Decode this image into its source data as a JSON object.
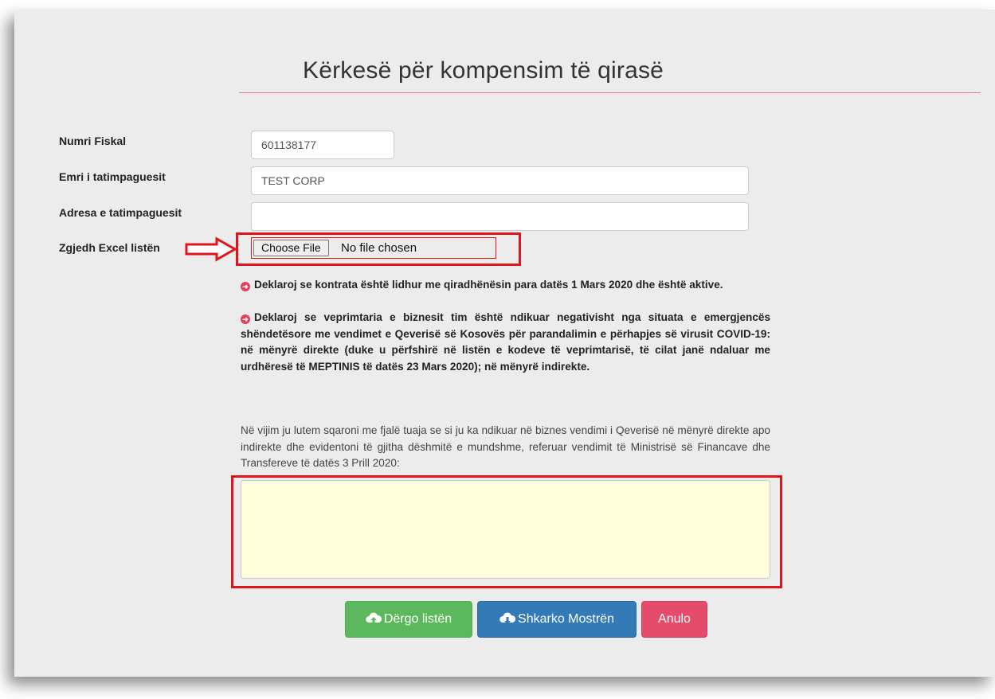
{
  "page": {
    "title": "Kërkesë për kompensim të qirasë"
  },
  "form": {
    "fiscal_number": {
      "label": "Numri Fiskal",
      "value": "601138177"
    },
    "taxpayer_name": {
      "label": "Emri i tatimpaguesit",
      "value": "TEST CORP"
    },
    "taxpayer_address": {
      "label": "Adresa e tatimpaguesit",
      "value": ""
    },
    "excel_file": {
      "label": "Zgjedh Excel listën",
      "button_label": "Choose File",
      "status": "No file chosen"
    }
  },
  "declarations": {
    "line1": "Deklaroj se kontrata është lidhur me qiradhënësin para datës 1 Mars 2020 dhe është aktive.",
    "line2": "Deklaroj se veprimtaria e biznesit tim është ndikuar negativisht nga situata e emergjencës shëndetësore me vendimet e Qeverisë së Kosovës për parandalimin e përhapjes së virusit COVID-19: në mënyrë direkte (duke u përfshirë në listën e kodeve të veprimtarisë, të cilat janë ndaluar me urdhëresë të MEPTINIS të datës 23 Mars 2020); në mënyrë indirekte."
  },
  "explanation": {
    "prompt": "Në vijim ju lutem sqaroni me fjalë tuaja se si ju ka ndikuar në biznes vendimi i Qeverisë në mënyrë direkte apo indirekte dhe evidentoni të gjitha dëshmitë e mundshme, referuar vendimit të Ministrisë së Financave dhe Transfereve të datës 3 Prill 2020:",
    "value": ""
  },
  "buttons": {
    "send": "Dërgo listën",
    "download": "Shkarko Mostrën",
    "cancel": "Anulo"
  },
  "icons": {
    "upload": "cloud-upload-icon",
    "download": "cloud-download-icon",
    "bullet": "circle-arrow-right-icon",
    "annotation": "arrow-right-icon"
  },
  "colors": {
    "send": "#5cb85c",
    "download": "#337ab7",
    "cancel": "#e34d6b",
    "highlight": "#e0141b",
    "textarea_bg": "#ffffdd"
  }
}
